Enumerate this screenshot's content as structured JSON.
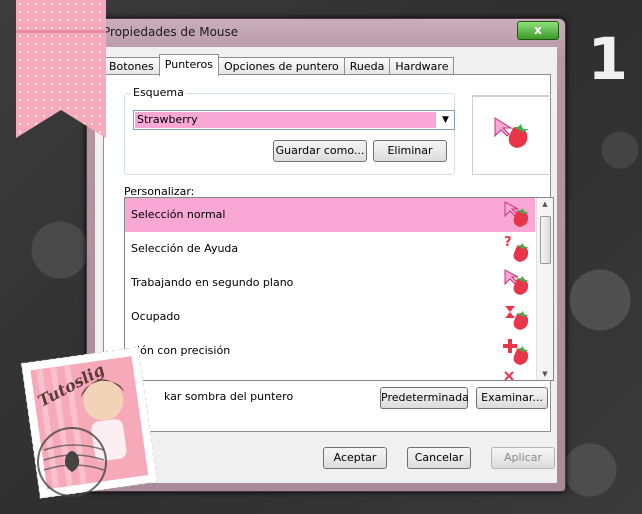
{
  "window": {
    "title": "Propiedades de Mouse",
    "close_label": "x"
  },
  "tabs": [
    {
      "label": "Botones"
    },
    {
      "label": "Punteros"
    },
    {
      "label": "Opciones de puntero"
    },
    {
      "label": "Rueda"
    },
    {
      "label": "Hardware"
    }
  ],
  "scheme": {
    "group_label": "Esquema",
    "selected": "Strawberry",
    "save_label": "Guardar como...",
    "delete_label": "Eliminar"
  },
  "customize": {
    "label": "Personalizar:",
    "items": [
      {
        "label": "Selección normal",
        "icon": "arrow-strawberry-icon"
      },
      {
        "label": "Selección de Ayuda",
        "icon": "help-strawberry-icon"
      },
      {
        "label": "Trabajando en segundo plano",
        "icon": "busy-arrow-strawberry-icon"
      },
      {
        "label": "Ocupado",
        "icon": "hourglass-strawberry-icon"
      },
      {
        "label": "ción con precisión",
        "icon": "crosshair-strawberry-icon"
      }
    ]
  },
  "shadow_label": "kar sombra del puntero",
  "defaults_label": "Predeterminada",
  "browse_label": "Examinar...",
  "footer": {
    "ok_label": "Aceptar",
    "cancel_label": "Cancelar",
    "apply_label": "Aplicar"
  },
  "overlay": {
    "number": "1",
    "stamp_text": "Tutoslig"
  },
  "colors": {
    "selection": "#f9a8d6",
    "ribbon": "#f6a9b9",
    "strawberry": "#e8354a"
  }
}
